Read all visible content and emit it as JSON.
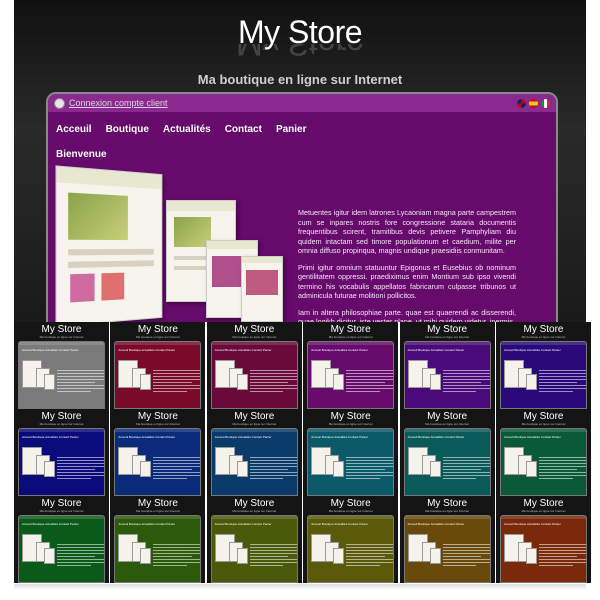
{
  "main": {
    "brand": "My Store",
    "tagline": "Ma boutique en ligne sur Internet",
    "login_link": "Connexion compte client",
    "nav": [
      "Acceuil",
      "Boutique",
      "Actualités",
      "Contact",
      "Panier"
    ],
    "welcome": "Bienvenue",
    "paragraphs": [
      "Metuentes igitur idem latrones Lycaoniam magna parte campestrem cum se inpares nostris fore congressione stataria documentis frequentibus scirent, tramitibus devis petivere Pamphyliam diu quidem intactam sed timore populationum et caedium, milite per omnia diffuso propinqua, magnis undique praesidiis conmunitam.",
      "Primi igitur omnium statuuntur Epigonus et Eusebius ob nominum gentilitatem oppressi. praediximus enim Montium sub ipso vivendi termino his vocabulis appellatos fabricarum culpasse tribunos ut adminicula futurae molitioni pollicitos.",
      "Iam in altera philosophiae parte. quae est quaerendi ac disserendi, quae logikh dicitur, iste vester plane, ut mihi quidem videtur, inermis"
    ],
    "languages": [
      "en",
      "es",
      "it"
    ],
    "colors": {
      "background": "#1a1a1a",
      "content": "#660a6c",
      "topbar": "#8a2a8e"
    }
  },
  "thumbnails": {
    "brand": "My Store",
    "subtitle": "Ma boutique en ligne sur Internet",
    "nav": "Acceuil  Boutique  Actualités  Contact  Panier",
    "colors": [
      "#7a7a7a",
      "#7a0a2a",
      "#6a0a3a",
      "#660a6c",
      "#4a0a7a",
      "#2a0a7a",
      "#0a0a7a",
      "#0a2a7a",
      "#0a3a6a",
      "#0a5a6a",
      "#0a5a5a",
      "#0a5a3a",
      "#0a5a1a",
      "#2a5a0a",
      "#4a5a0a",
      "#5a5a0a",
      "#6a4a0a",
      "#7a2a0a"
    ]
  }
}
